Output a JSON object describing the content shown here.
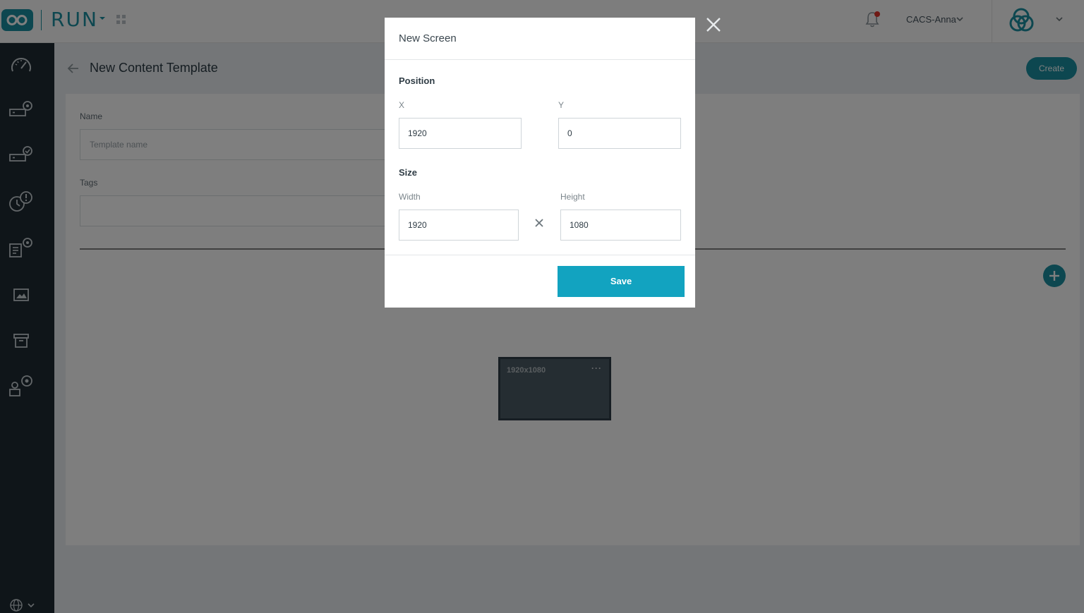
{
  "app": {
    "name": "RUN"
  },
  "header": {
    "user_name": "CACS-Anna"
  },
  "page": {
    "title": "New Content Template",
    "create_label": "Create",
    "name_label": "Name",
    "name_placeholder": "Template name",
    "tags_label": "Tags",
    "screen_card_label": "1920x1080",
    "screen_card_menu": "···"
  },
  "modal": {
    "title": "New Screen",
    "position_title": "Position",
    "x_label": "X",
    "x_value": "1920",
    "y_label": "Y",
    "y_value": "0",
    "size_title": "Size",
    "width_label": "Width",
    "width_value": "1920",
    "height_label": "Height",
    "height_value": "1080",
    "save_label": "Save"
  },
  "colors": {
    "brand": "#1a8fa0",
    "save_button": "#12a3c0",
    "sidebar": "#1e2a33",
    "notification_dot": "#e0352b"
  },
  "icons": {
    "sidebar": [
      "dashboard-icon",
      "device-settings-icon",
      "device-check-icon",
      "alert-clock-icon",
      "content-settings-icon",
      "image-icon",
      "archive-icon",
      "user-settings-icon"
    ]
  }
}
